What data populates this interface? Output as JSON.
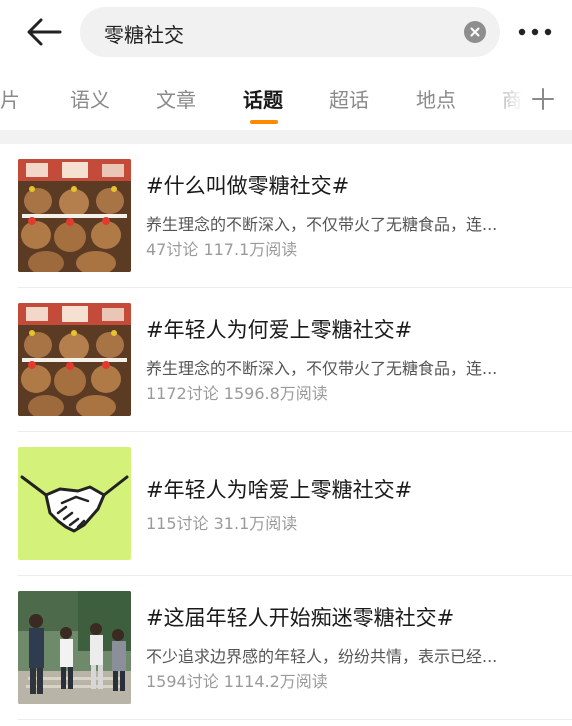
{
  "search": {
    "query": "零糖社交"
  },
  "icons": {
    "back": "arrow-left-icon",
    "clear": "clear-circle-icon",
    "more": "more-dots-icon",
    "add_tab": "plus-icon"
  },
  "tabs": [
    {
      "label": "图片",
      "active": false
    },
    {
      "label": "语义",
      "active": false
    },
    {
      "label": "文章",
      "active": false
    },
    {
      "label": "话题",
      "active": true
    },
    {
      "label": "超话",
      "active": false
    },
    {
      "label": "地点",
      "active": false
    },
    {
      "label": "商",
      "active": false
    }
  ],
  "colors": {
    "accent": "#ff8a00",
    "thumb_green": "#d4f27a"
  },
  "topics": [
    {
      "title": "#什么叫做零糖社交#",
      "desc": "养生理念的不断深入，不仅带火了无糖食品，连...",
      "meta": "47讨论 117.1万阅读",
      "thumb": "plush-toys"
    },
    {
      "title": "#年轻人为何爱上零糖社交#",
      "desc": "养生理念的不断深入，不仅带火了无糖食品，连...",
      "meta": "1172讨论 1596.8万阅读",
      "thumb": "plush-toys"
    },
    {
      "title": "#年轻人为啥爱上零糖社交#",
      "desc": "",
      "meta": "115讨论 31.1万阅读",
      "thumb": "handshake"
    },
    {
      "title": "#这届年轻人开始痴迷零糖社交#",
      "desc": "不少追求边界感的年轻人，纷纷共情，表示已经...",
      "meta": "1594讨论 1114.2万阅读",
      "thumb": "people-photo"
    }
  ]
}
